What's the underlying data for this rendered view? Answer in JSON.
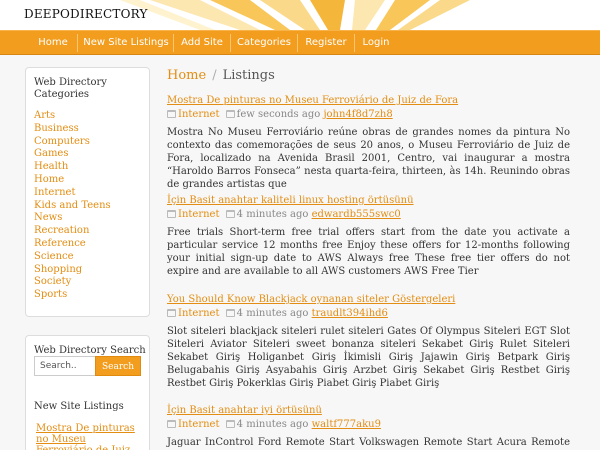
{
  "site": {
    "title": "DEEPODIRECTORY"
  },
  "nav": [
    "Home",
    "New Site Listings",
    "Add Site",
    "Categories",
    "Register",
    "Login"
  ],
  "sidebar": {
    "categories_title": "Web Directory Categories",
    "categories": [
      "Arts",
      "Business",
      "Computers",
      "Games",
      "Health",
      "Home",
      "Internet",
      "Kids and Teens",
      "News",
      "Recreation",
      "Reference",
      "Science",
      "Shopping",
      "Society",
      "Sports"
    ],
    "search_title": "Web Directory Search",
    "search_placeholder": "Search..",
    "search_button": "Search",
    "new_listings_title": "New Site Listings",
    "new_listings": [
      "Mostra De pinturas no Museu Ferroviário de Juiz"
    ]
  },
  "breadcrumb": {
    "home": "Home",
    "separator": "/",
    "current": "Listings"
  },
  "listings": [
    {
      "title": "Mostra De pinturas no Museu Ferroviário de Juiz de Fora",
      "category": "Internet",
      "time": "few seconds ago",
      "user": "john4f8d7zh8",
      "description": "Mostra No Museu Ferroviário reúne obras de grandes nomes da pintura No contexto das comemorações de seus 20 anos, o Museu Ferroviário de Juiz de Fora, localizado na Avenida Brasil 2001, Centro, vai inaugurar a mostra “Haroldo Barros Fonseca” nesta quarta-feira, thirteen, às 14h. Reunindo obras de grandes artistas que"
    },
    {
      "title": "İçin Basit anahtar kaliteli linux hosting örtüsünü",
      "category": "Internet",
      "time": "4 minutes ago",
      "user": "edwardb555swc0",
      "description": "Free trials Short-term free trial offers start from the date you activate a particular service 12 months free Enjoy these offers for 12-months following your initial sign-up date to AWS Always free These free tier offers do not expire and are available to all AWS customers AWS Free Tier"
    },
    {
      "title": "You Should Know Blackjack oynanan siteler Göstergeleri",
      "category": "Internet",
      "time": "4 minutes ago",
      "user": "traudlt394ihd6",
      "description": "Slot siteleri blackjack siteleri rulet siteleri Gates Of Olympus Siteleri EGT Slot Siteleri Aviator Siteleri sweet bonanza siteleri Sekabet Giriş Rulet Siteleri Sekabet Giriş Holiganbet Giriş İkimisli Giriş Jajawin Giriş Betpark Giriş Belugabahis Giriş Asyabahis Giriş Arzbet Giriş Sekabet Giriş Restbet Giriş Restbet Giriş Pokerklas Giriş Piabet Giriş Piabet Giriş"
    },
    {
      "title": "İçin Basit anahtar iyi örtüsünü",
      "category": "Internet",
      "time": "4 minutes ago",
      "user": "waltf777aku9",
      "description": "Jaguar InControl Ford Remote Start Volkswagen Remote Start Acura Remote Start Buick"
    }
  ]
}
